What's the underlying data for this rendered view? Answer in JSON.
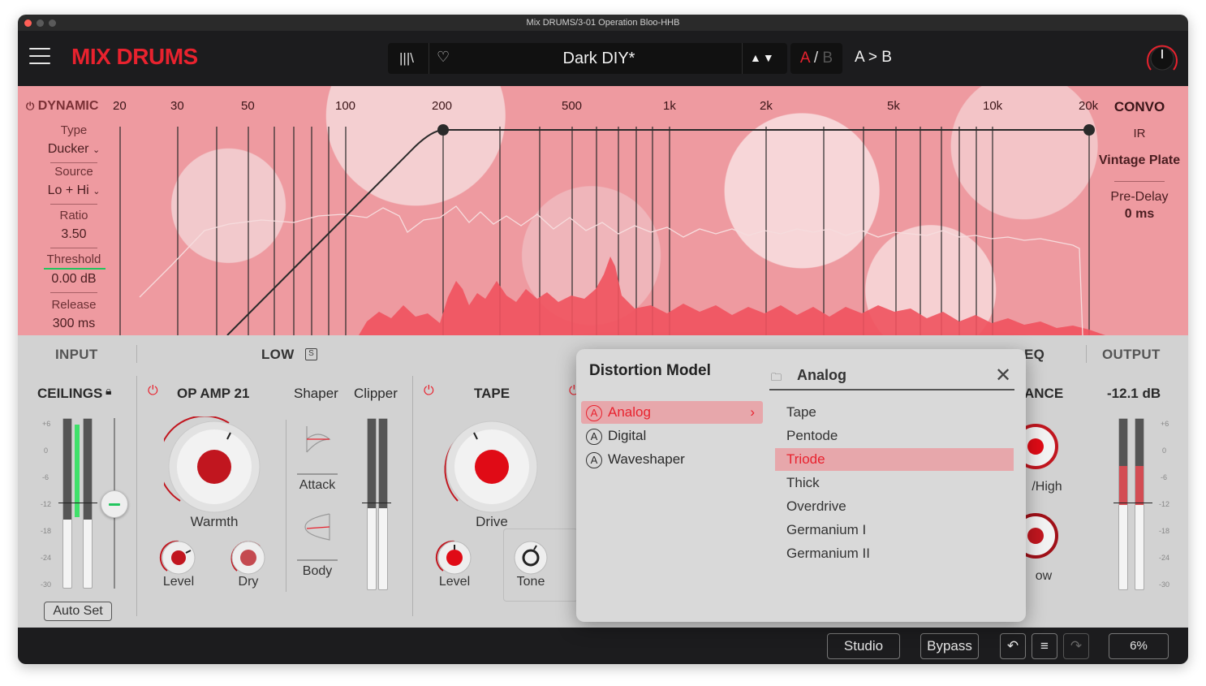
{
  "window": {
    "title": "Mix DRUMS/3-01 Operation Bloo-HHB"
  },
  "header": {
    "brand": "MIX DRUMS",
    "preset_name": "Dark DIY*",
    "preset_arrows": "▲▼",
    "ab_a": "A",
    "ab_sep": "/",
    "ab_b": "B",
    "a_to_b": "A > B"
  },
  "dynamic": {
    "title": "DYNAMIC",
    "type_label": "Type",
    "type_value": "Ducker",
    "source_label": "Source",
    "source_value": "Lo + Hi",
    "ratio_label": "Ratio",
    "ratio_value": "3.50",
    "threshold_label": "Threshold",
    "threshold_value": "0.00 dB",
    "release_label": "Release",
    "release_value": "300 ms"
  },
  "freq_labels": [
    "20",
    "30",
    "50",
    "100",
    "200",
    "500",
    "1k",
    "2k",
    "5k",
    "10k",
    "20k"
  ],
  "convo": {
    "title": "CONVO",
    "ir_label": "IR",
    "ir_value": "Vintage Plate",
    "predelay_label": "Pre-Delay",
    "predelay_value": "0 ms"
  },
  "sections": {
    "input": "INPUT",
    "low": "LOW",
    "eq": "EQ",
    "output": "OUTPUT",
    "ance": "ANCE"
  },
  "input": {
    "ceilings": "CEILINGS",
    "auto_set": "Auto Set",
    "ticks": [
      "+6",
      "0",
      "-6",
      "-12",
      "-18",
      "-24",
      "-30"
    ]
  },
  "opamp": {
    "name": "OP AMP 21",
    "shaper": "Shaper",
    "clipper": "Clipper",
    "warmth": "Warmth",
    "level": "Level",
    "dry": "Dry",
    "attack": "Attack",
    "body": "Body"
  },
  "tape": {
    "name": "TAPE",
    "drive": "Drive",
    "level": "Level",
    "tone": "Tone"
  },
  "balance": {
    "high": "/High",
    "low": "ow"
  },
  "output": {
    "value": "-12.1 dB",
    "ticks": [
      "+6",
      "0",
      "-6",
      "-12",
      "-18",
      "-24",
      "-30"
    ]
  },
  "popup": {
    "title": "Distortion Model",
    "category_header": "Analog",
    "categories": [
      "Analog",
      "Digital",
      "Waveshaper"
    ],
    "models": [
      "Tape",
      "Pentode",
      "Triode",
      "Thick",
      "Overdrive",
      "Germanium I",
      "Germanium II"
    ],
    "selected_model": "Triode",
    "category_icon": "A"
  },
  "footer": {
    "studio": "Studio",
    "bypass": "Bypass",
    "cpu": "6%"
  },
  "colors": {
    "accent": "#e8222e",
    "eq_bg": "#ee9aa0",
    "panel": "#d2d2d2",
    "bar": "#1c1c1e"
  }
}
